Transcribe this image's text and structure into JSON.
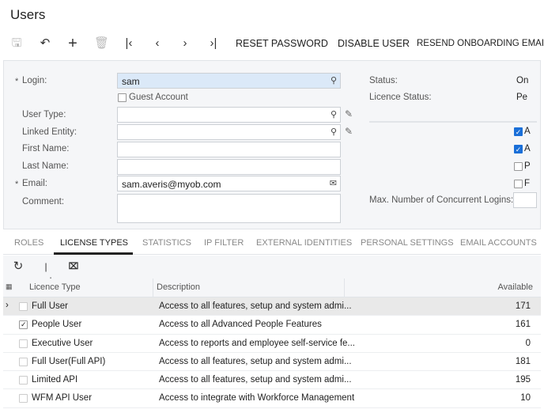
{
  "title": "Users",
  "toolbar": {
    "icons": [
      "save-icon",
      "undo-icon",
      "add-icon",
      "delete-icon",
      "first-icon",
      "prev-icon",
      "next-icon",
      "last-icon"
    ],
    "reset_password": "RESET PASSWORD",
    "disable_user": "DISABLE USER",
    "resend": "RESEND ONBOARDING EMAIL"
  },
  "form": {
    "login_label": "Login:",
    "login_value": "sam",
    "guest_label": "Guest Account",
    "user_type_label": "User Type:",
    "user_type_value": "",
    "linked_entity_label": "Linked Entity:",
    "linked_entity_value": "",
    "first_name_label": "First Name:",
    "first_name_value": "",
    "last_name_label": "Last Name:",
    "last_name_value": "",
    "email_label": "Email:",
    "email_value": "sam.averis@myob.com",
    "comment_label": "Comment:",
    "comment_value": "",
    "status_label": "Status:",
    "status_value": "On",
    "licence_status_label": "Licence Status:",
    "licence_status_value": "Pe",
    "options": [
      {
        "label": "A",
        "checked": true
      },
      {
        "label": "A",
        "checked": true
      },
      {
        "label": "P",
        "checked": false
      },
      {
        "label": "F",
        "checked": false
      }
    ],
    "max_logins_label": "Max. Number of Concurrent Logins:",
    "max_logins_value": ""
  },
  "tabs": [
    "ROLES",
    "LICENSE TYPES",
    "STATISTICS",
    "IP FILTER",
    "EXTERNAL IDENTITIES",
    "PERSONAL SETTINGS",
    "EMAIL ACCOUNTS"
  ],
  "active_tab": "LICENSE TYPES",
  "grid": {
    "headers": {
      "type": "Licence Type",
      "description": "Description",
      "available": "Available"
    },
    "rows": [
      {
        "type": "Full User",
        "description": "Access to all features, setup and system admi...",
        "available": "171",
        "checked": false,
        "selected": true
      },
      {
        "type": "People User",
        "description": "Access to all Advanced People Features",
        "available": "161",
        "checked": true
      },
      {
        "type": "Executive User",
        "description": "Access to reports and employee self-service fe...",
        "available": "0",
        "checked": false
      },
      {
        "type": "Full User(Full API)",
        "description": "Access to all features, setup and system admi...",
        "available": "181",
        "checked": false
      },
      {
        "type": "Limited API",
        "description": "Access to all features, setup and system admi...",
        "available": "195",
        "checked": false
      },
      {
        "type": "WFM API User",
        "description": "Access to integrate with Workforce Management",
        "available": "10",
        "checked": false
      }
    ]
  }
}
